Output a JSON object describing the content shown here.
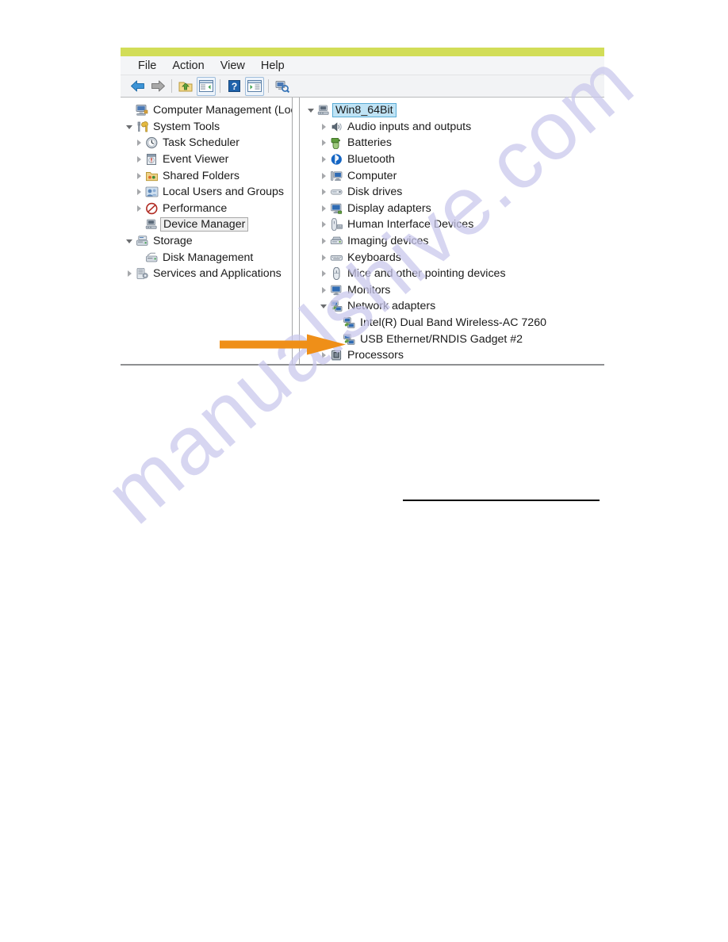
{
  "window": {
    "accent_color": "#d2dd58",
    "menu": [
      {
        "label": "File"
      },
      {
        "label": "Action"
      },
      {
        "label": "View"
      },
      {
        "label": "Help"
      }
    ],
    "toolbar": [
      {
        "name": "back-icon",
        "title": "Back"
      },
      {
        "name": "forward-icon",
        "title": "Forward"
      },
      {
        "name": "separator",
        "title": ""
      },
      {
        "name": "up-folder-icon",
        "title": "Up one level"
      },
      {
        "name": "show-hide-console-tree-icon",
        "title": "Show/Hide Console Tree"
      },
      {
        "name": "separator",
        "title": ""
      },
      {
        "name": "help-icon",
        "title": "Help"
      },
      {
        "name": "show-hide-action-pane-icon",
        "title": "Show/Hide Action Pane"
      },
      {
        "name": "separator",
        "title": ""
      },
      {
        "name": "scan-hardware-changes-icon",
        "title": "Scan for hardware changes"
      }
    ]
  },
  "console_tree": {
    "items": [
      {
        "label": "Computer Management (Local",
        "indent": 0,
        "twisty": "none",
        "icon": "computer-management-icon",
        "state": "normal"
      },
      {
        "label": "System Tools",
        "indent": 0,
        "twisty": "expanded",
        "icon": "system-tools-icon",
        "state": "normal"
      },
      {
        "label": "Task Scheduler",
        "indent": 1,
        "twisty": "collapsed",
        "icon": "task-scheduler-icon",
        "state": "normal"
      },
      {
        "label": "Event Viewer",
        "indent": 1,
        "twisty": "collapsed",
        "icon": "event-viewer-icon",
        "state": "normal"
      },
      {
        "label": "Shared Folders",
        "indent": 1,
        "twisty": "collapsed",
        "icon": "shared-folders-icon",
        "state": "normal"
      },
      {
        "label": "Local Users and Groups",
        "indent": 1,
        "twisty": "collapsed",
        "icon": "local-users-icon",
        "state": "normal"
      },
      {
        "label": "Performance",
        "indent": 1,
        "twisty": "collapsed",
        "icon": "performance-icon",
        "state": "normal"
      },
      {
        "label": "Device Manager",
        "indent": 1,
        "twisty": "none",
        "icon": "device-manager-icon",
        "state": "selected"
      },
      {
        "label": "Storage",
        "indent": 0,
        "twisty": "expanded",
        "icon": "storage-icon",
        "state": "normal"
      },
      {
        "label": "Disk Management",
        "indent": 1,
        "twisty": "none",
        "icon": "disk-management-icon",
        "state": "normal"
      },
      {
        "label": "Services and Applications",
        "indent": 0,
        "twisty": "collapsed",
        "icon": "services-apps-icon",
        "state": "normal"
      }
    ]
  },
  "device_tree": {
    "items": [
      {
        "label": "Win8_64Bit",
        "indent": 0,
        "twisty": "expanded",
        "icon": "computer-root-icon",
        "state": "focused"
      },
      {
        "label": "Audio inputs and outputs",
        "indent": 1,
        "twisty": "collapsed",
        "icon": "audio-icon",
        "state": "normal"
      },
      {
        "label": "Batteries",
        "indent": 1,
        "twisty": "collapsed",
        "icon": "battery-icon",
        "state": "normal"
      },
      {
        "label": "Bluetooth",
        "indent": 1,
        "twisty": "collapsed",
        "icon": "bluetooth-icon",
        "state": "normal"
      },
      {
        "label": "Computer",
        "indent": 1,
        "twisty": "collapsed",
        "icon": "computer-icon",
        "state": "normal"
      },
      {
        "label": "Disk drives",
        "indent": 1,
        "twisty": "collapsed",
        "icon": "disk-drive-icon",
        "state": "normal"
      },
      {
        "label": "Display adapters",
        "indent": 1,
        "twisty": "collapsed",
        "icon": "display-adapter-icon",
        "state": "normal"
      },
      {
        "label": "Human Interface Devices",
        "indent": 1,
        "twisty": "collapsed",
        "icon": "hid-icon",
        "state": "normal"
      },
      {
        "label": "Imaging devices",
        "indent": 1,
        "twisty": "collapsed",
        "icon": "imaging-icon",
        "state": "normal"
      },
      {
        "label": "Keyboards",
        "indent": 1,
        "twisty": "collapsed",
        "icon": "keyboard-icon",
        "state": "normal"
      },
      {
        "label": "Mice and other pointing devices",
        "indent": 1,
        "twisty": "collapsed",
        "icon": "mouse-icon",
        "state": "normal"
      },
      {
        "label": "Monitors",
        "indent": 1,
        "twisty": "collapsed",
        "icon": "monitor-icon",
        "state": "normal"
      },
      {
        "label": "Network adapters",
        "indent": 1,
        "twisty": "expanded",
        "icon": "network-adapter-icon",
        "state": "normal"
      },
      {
        "label": "Intel(R) Dual Band Wireless-AC 7260",
        "indent": 2,
        "twisty": "none",
        "icon": "network-adapter-icon",
        "state": "normal"
      },
      {
        "label": "USB Ethernet/RNDIS Gadget #2",
        "indent": 2,
        "twisty": "none",
        "icon": "network-adapter-icon",
        "state": "normal"
      },
      {
        "label": "Processors",
        "indent": 1,
        "twisty": "collapsed",
        "icon": "processor-icon",
        "state": "normal"
      }
    ]
  },
  "annotation": {
    "arrow": {
      "name": "orange-callout-arrow",
      "color": "#ef8f18",
      "points_to": "USB Ethernet/RNDIS Gadget #2"
    }
  },
  "watermark": {
    "text": "manualshive.com",
    "color": "#c9c7ec"
  }
}
